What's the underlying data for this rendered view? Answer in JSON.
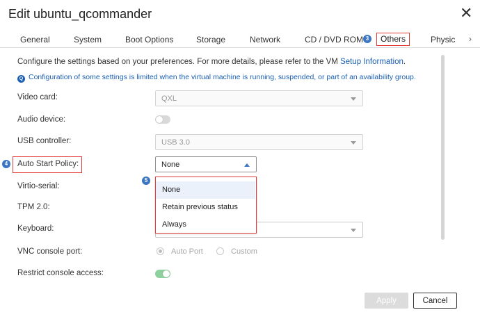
{
  "dialog": {
    "title": "Edit ubuntu_qcommander",
    "close_symbol": "✕"
  },
  "tabs": {
    "items": [
      "General",
      "System",
      "Boot Options",
      "Storage",
      "Network",
      "CD / DVD ROM",
      "Others",
      "Physic"
    ],
    "active": "Others",
    "scroll_icon": "chevron-right-icon"
  },
  "annotations": {
    "tab_step": "3",
    "policy_step": "4",
    "dropdown_step": "5"
  },
  "intro": {
    "text": "Configure the settings based on your preferences. For more details, please refer to the VM",
    "link": "Setup Information",
    "end": ".",
    "notice": "Configuration of some settings is limited when the virtual machine is running, suspended, or part of an availability group."
  },
  "fields": {
    "video_card": {
      "label": "Video card:",
      "value": "QXL"
    },
    "audio_device": {
      "label": "Audio device:",
      "enabled": false
    },
    "usb_controller": {
      "label": "USB controller:",
      "value": "USB 3.0"
    },
    "auto_start_policy": {
      "label": "Auto Start Policy:",
      "value": "None",
      "options": [
        "None",
        "Retain previous status",
        "Always"
      ]
    },
    "virtio_serial": {
      "label": "Virtio-serial:"
    },
    "tpm": {
      "label": "TPM 2.0:"
    },
    "keyboard": {
      "label": "Keyboard:"
    },
    "vnc_console_port": {
      "label": "VNC console port:",
      "options": [
        "Auto Port",
        "Custom"
      ],
      "selected": "Auto Port"
    },
    "restrict_console_access": {
      "label": "Restrict console access:",
      "enabled": true
    }
  },
  "buttons": {
    "apply": "Apply",
    "cancel": "Cancel"
  },
  "colors": {
    "accent": "#3a76c4",
    "highlight": "#e53935",
    "toggle_on": "#8fd19e",
    "toggle_off": "#d9d9d9",
    "link": "#1a5fb4"
  }
}
